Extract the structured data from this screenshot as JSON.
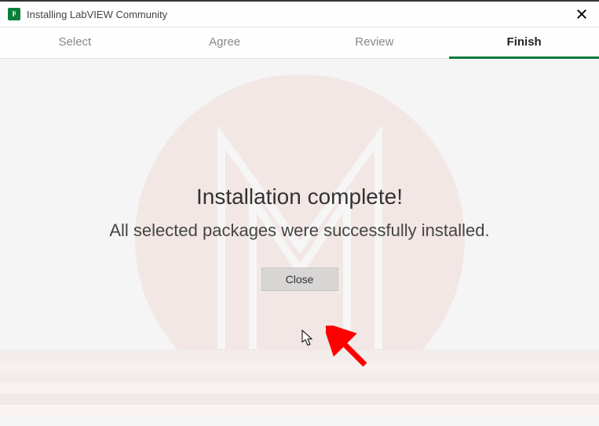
{
  "titlebar": {
    "title": "Installing LabVIEW Community"
  },
  "tabs": {
    "items": [
      {
        "label": "Select"
      },
      {
        "label": "Agree"
      },
      {
        "label": "Review"
      },
      {
        "label": "Finish"
      }
    ]
  },
  "content": {
    "headline": "Installation complete!",
    "subline": "All selected packages were successfully installed.",
    "close_label": "Close"
  }
}
